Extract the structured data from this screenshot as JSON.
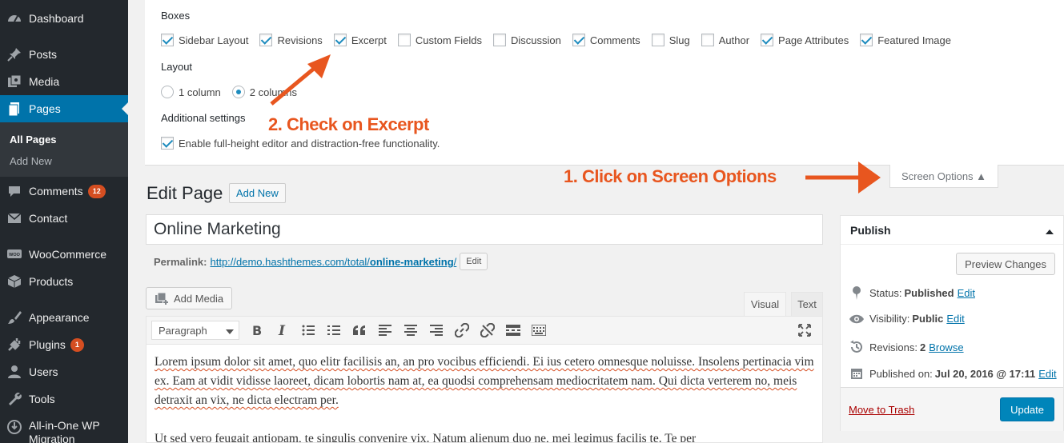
{
  "sidebar": {
    "items": [
      {
        "label": "Dashboard",
        "icon": "dashboard-icon"
      },
      {
        "label": "Posts",
        "icon": "pin-icon"
      },
      {
        "label": "Media",
        "icon": "media-icon"
      },
      {
        "label": "Pages",
        "icon": "pages-icon"
      },
      {
        "label": "Comments",
        "icon": "comments-icon",
        "badge": "12"
      },
      {
        "label": "Contact",
        "icon": "mail-icon"
      },
      {
        "label": "WooCommerce",
        "icon": "woo-icon"
      },
      {
        "label": "Products",
        "icon": "box-icon"
      },
      {
        "label": "Appearance",
        "icon": "brush-icon"
      },
      {
        "label": "Plugins",
        "icon": "plug-icon",
        "badge": "1"
      },
      {
        "label": "Users",
        "icon": "user-icon"
      },
      {
        "label": "Tools",
        "icon": "wrench-icon"
      },
      {
        "label": "All-in-One WP",
        "label2": "Migration",
        "icon": "migration-icon"
      }
    ],
    "submenu": [
      {
        "label": "All Pages"
      },
      {
        "label": "Add New"
      }
    ],
    "woo_badge_text": "WOO"
  },
  "screen_options": {
    "boxes_heading": "Boxes",
    "boxes": [
      {
        "label": "Sidebar Layout",
        "checked": true
      },
      {
        "label": "Revisions",
        "checked": true
      },
      {
        "label": "Excerpt",
        "checked": true
      },
      {
        "label": "Custom Fields",
        "checked": false
      },
      {
        "label": "Discussion",
        "checked": false
      },
      {
        "label": "Comments",
        "checked": true
      },
      {
        "label": "Slug",
        "checked": false
      },
      {
        "label": "Author",
        "checked": false
      },
      {
        "label": "Page Attributes",
        "checked": true
      },
      {
        "label": "Featured Image",
        "checked": true
      }
    ],
    "layout_heading": "Layout",
    "layout_options": [
      {
        "label": "1 column",
        "checked": false
      },
      {
        "label": "2 columns",
        "checked": true
      }
    ],
    "additional_heading": "Additional settings",
    "additional_option": {
      "label": "Enable full-height editor and distraction-free functionality.",
      "checked": true
    },
    "tab_label": "Screen Options ▲"
  },
  "annotations": {
    "step1": "1. Click on Screen Options",
    "step2": "2. Check on Excerpt",
    "color": "#e8561f"
  },
  "editor": {
    "page_title": "Edit Page",
    "add_new": "Add New",
    "title_value": "Online Marketing",
    "permalink_label": "Permalink:",
    "permalink_base": "http://demo.hashthemes.com/total/",
    "permalink_slug": "online-marketing",
    "permalink_end": "/",
    "permalink_edit": "Edit",
    "add_media": "Add Media",
    "tab_visual": "Visual",
    "tab_text": "Text",
    "format_select": "Paragraph",
    "paragraphs": [
      "Lorem ipsum dolor sit amet, quo elitr facilisis an, an pro vocibus efficiendi. Ei ius cetero omnesque noluisse. Insolens pertinacia vim ex. Eam at vidit vidisse laoreet, dicam lobortis nam at, ea quodsi comprehensam mediocritatem nam. Qui dicta verterem no, meis detraxit an vix, ne dicta electram per.",
      "Ut sed vero feugait antiopam, te singulis convenire vix. Natum alienum duo ne, mei legimus facilis te. Te per"
    ]
  },
  "publish": {
    "title": "Publish",
    "preview": "Preview Changes",
    "status_label": "Status:",
    "status_value": "Published",
    "visibility_label": "Visibility:",
    "visibility_value": "Public",
    "revisions_label": "Revisions:",
    "revisions_value": "2",
    "revisions_link": "Browse",
    "published_label": "Published on:",
    "published_value": "Jul 20, 2016 @ 17:11",
    "edit": "Edit",
    "trash": "Move to Trash",
    "update": "Update"
  }
}
